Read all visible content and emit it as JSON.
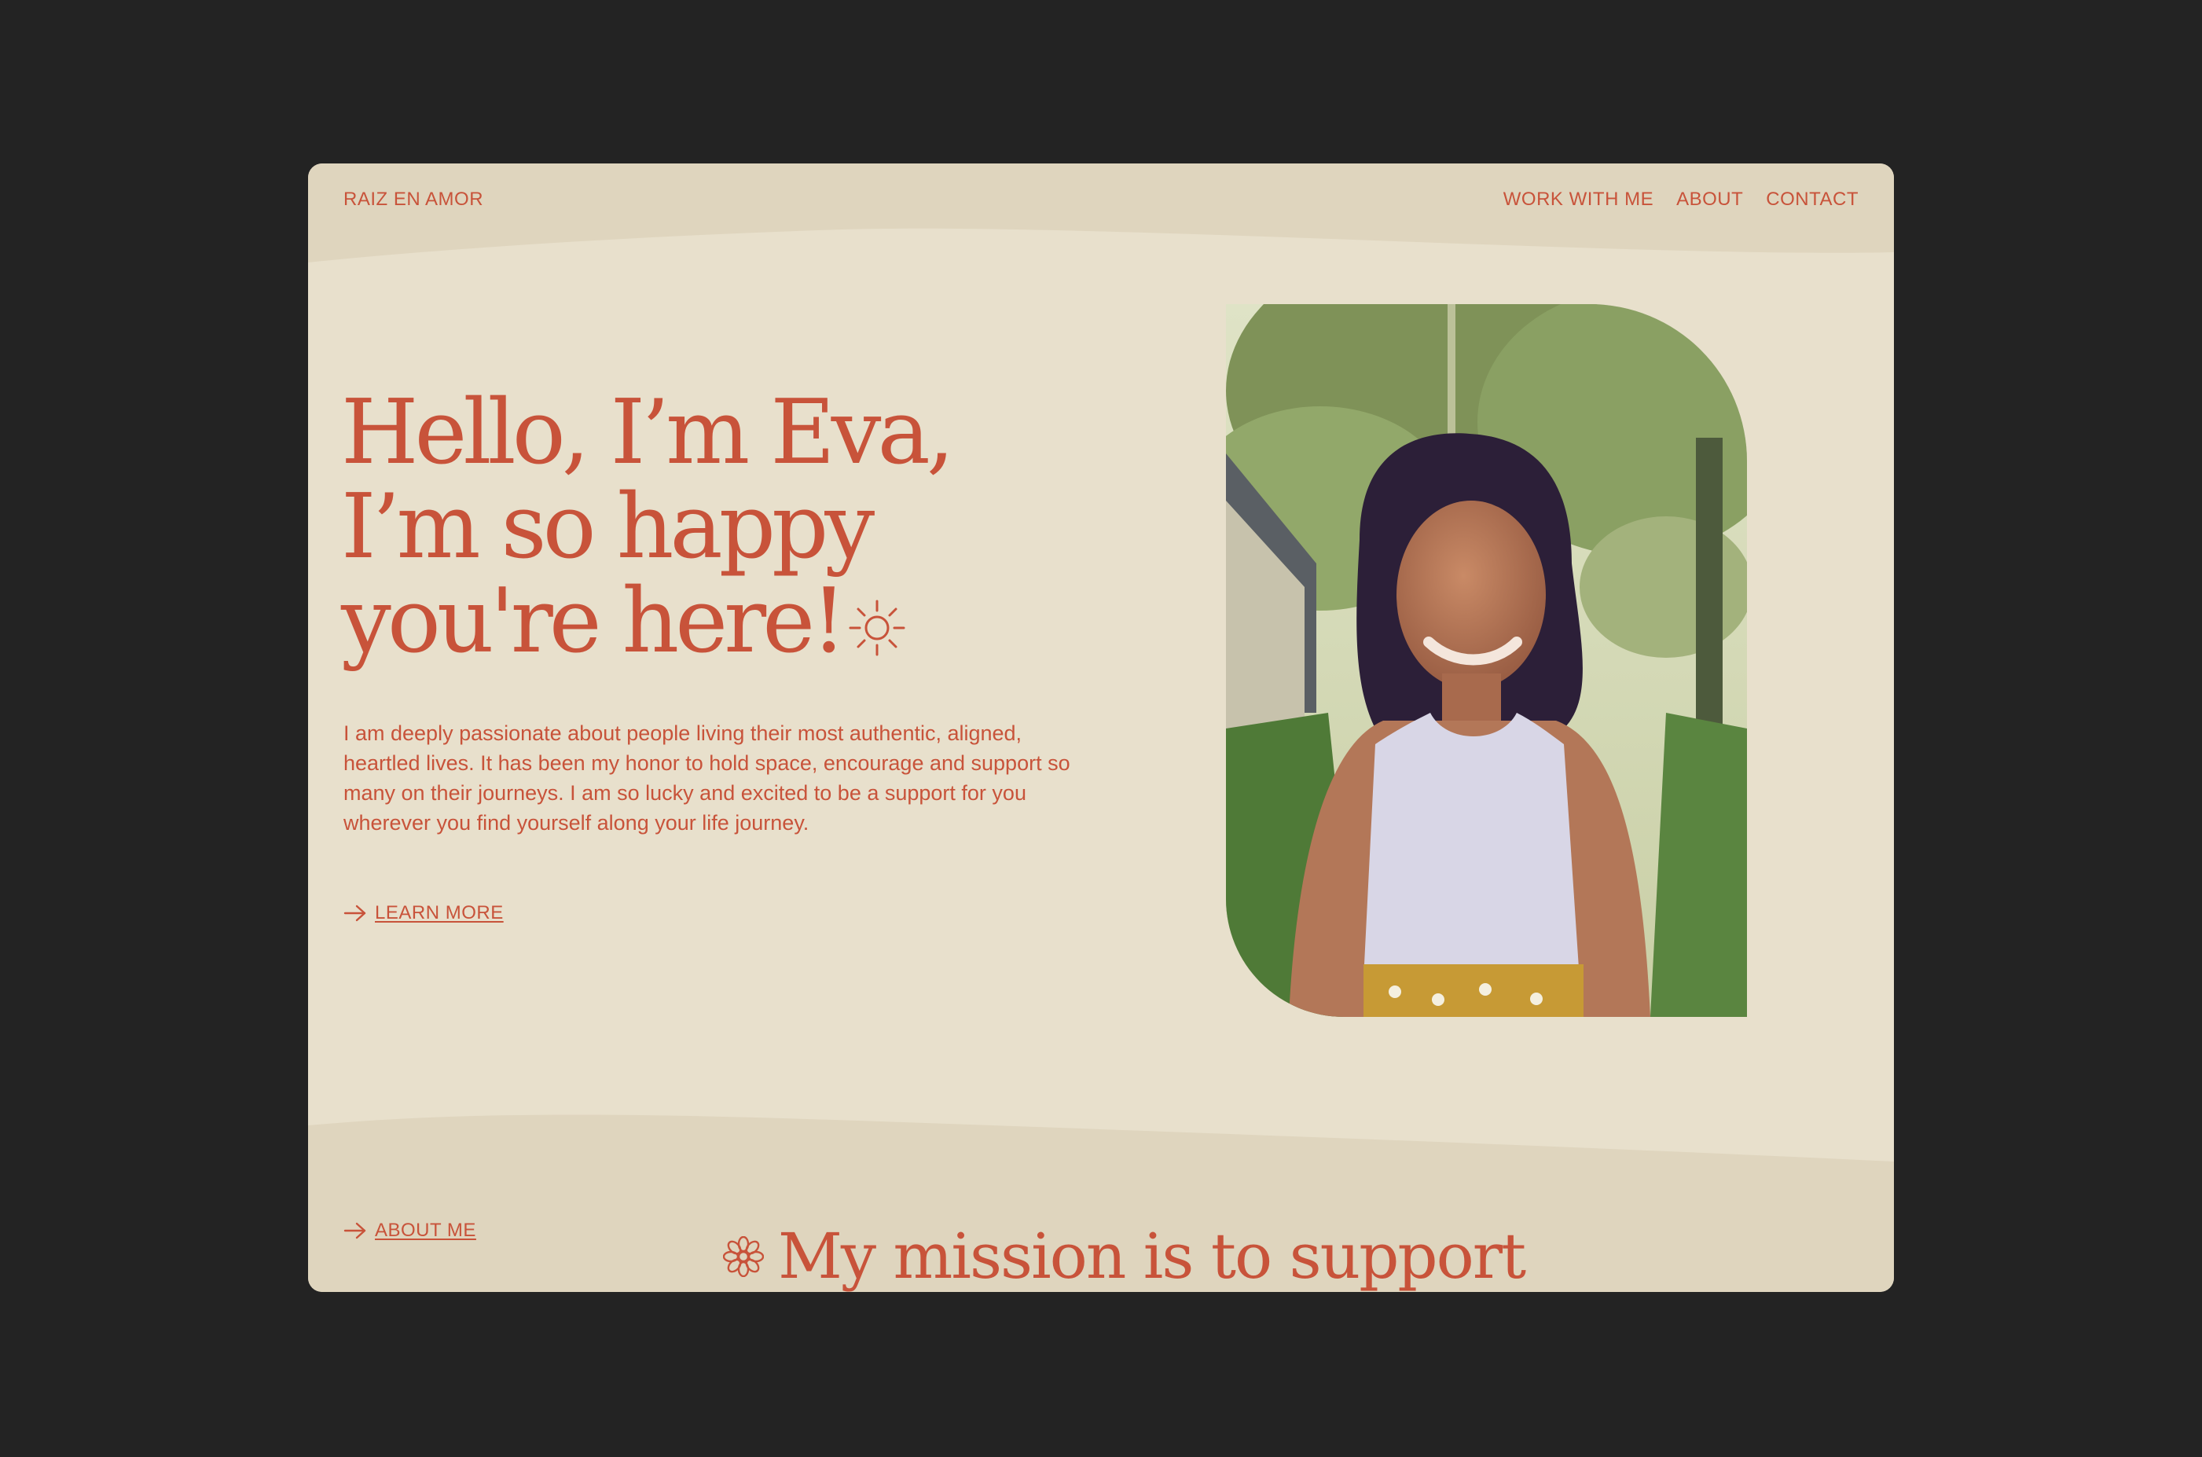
{
  "header": {
    "logo": "RAIZ EN AMOR",
    "nav": [
      "WORK WITH ME",
      "ABOUT",
      "CONTACT"
    ]
  },
  "hero": {
    "headline_lines": [
      "Hello, I’m Eva,",
      "I’m so happy",
      "you're here!"
    ],
    "body": "I am deeply passionate about people living their most authentic, aligned, heartled lives. It has been my honor to hold space, encourage and support so many on their journeys. I am so lucky and excited to be a support for you wherever you find yourself along your life journey.",
    "cta_label": "LEARN MORE"
  },
  "next_section": {
    "cta_label": "ABOUT ME",
    "heading": "My mission is to support"
  },
  "colors": {
    "page_background": "#232323",
    "site_background": "#e8e0cc",
    "band_background": "#dfd5be",
    "accent": "#c8533a"
  },
  "icons": [
    "sun-icon",
    "arrow-right-icon",
    "flower-icon"
  ]
}
